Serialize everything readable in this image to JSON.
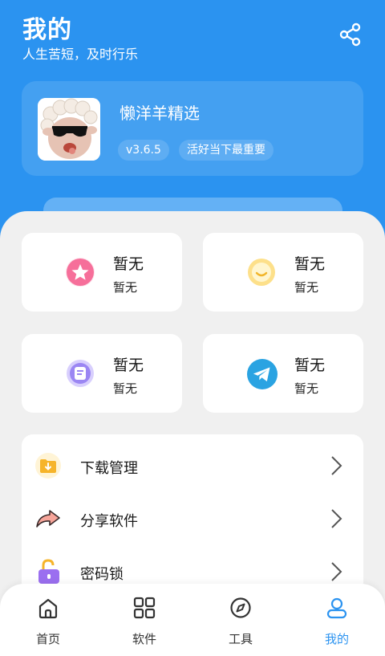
{
  "colors": {
    "brand": "#2b93f0",
    "card": "#ffffff",
    "background": "#f0f0f0"
  },
  "header": {
    "title": "我的",
    "subtitle": "人生苦短，及时行乐",
    "share_icon": "share-icon"
  },
  "app_info": {
    "name": "懒洋羊精选",
    "version": "v3.6.5",
    "slogan": "活好当下最重要",
    "icon": "sheep-with-sunglasses-avatar"
  },
  "stats": [
    {
      "icon": "star-icon",
      "value": "暂无",
      "label": "暂无"
    },
    {
      "icon": "smile-icon",
      "value": "暂无",
      "label": "暂无"
    },
    {
      "icon": "note-icon",
      "value": "暂无",
      "label": "暂无"
    },
    {
      "icon": "telegram-icon",
      "value": "暂无",
      "label": "暂无"
    }
  ],
  "menu": [
    {
      "icon": "download-folder-icon",
      "label": "下载管理"
    },
    {
      "icon": "share-arrow-icon",
      "label": "分享软件"
    },
    {
      "icon": "lock-icon",
      "label": "密码锁"
    }
  ],
  "tabs": [
    {
      "icon": "home-icon",
      "label": "首页",
      "active": false
    },
    {
      "icon": "apps-grid-icon",
      "label": "软件",
      "active": false
    },
    {
      "icon": "compass-icon",
      "label": "工具",
      "active": false
    },
    {
      "icon": "user-icon",
      "label": "我的",
      "active": true
    }
  ]
}
